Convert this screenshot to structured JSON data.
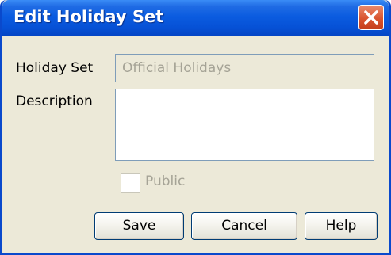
{
  "dialog": {
    "title": "Edit Holiday Set",
    "close_icon": "close-icon"
  },
  "form": {
    "holiday_set_label": "Holiday Set",
    "holiday_set_value": "Official Holidays",
    "description_label": "Description",
    "description_value": "",
    "public_label": "Public",
    "public_checked": false
  },
  "buttons": {
    "save_label": "Save",
    "cancel_label": "Cancel",
    "help_label": "Help"
  },
  "colors": {
    "titlebar_blue": "#0651d6",
    "close_red": "#d9542f",
    "dialog_background": "#ece9d8",
    "field_border": "#7f9db9",
    "disabled_text": "#a5a396"
  }
}
